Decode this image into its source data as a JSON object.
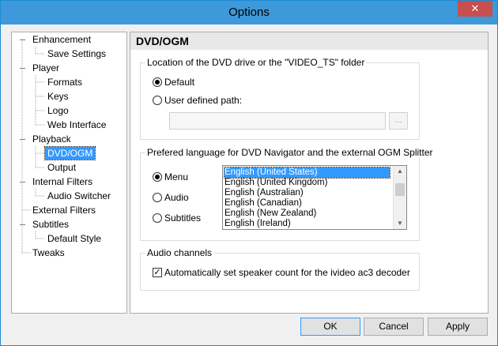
{
  "window": {
    "title": "Options",
    "close_glyph": "✕"
  },
  "tree": {
    "items": [
      {
        "label": "Enhancement",
        "level": 0
      },
      {
        "label": "Save Settings",
        "level": 1
      },
      {
        "label": "Player",
        "level": 0
      },
      {
        "label": "Formats",
        "level": 1
      },
      {
        "label": "Keys",
        "level": 1
      },
      {
        "label": "Logo",
        "level": 1
      },
      {
        "label": "Web Interface",
        "level": 1
      },
      {
        "label": "Playback",
        "level": 0
      },
      {
        "label": "DVD/OGM",
        "level": 1,
        "selected": true
      },
      {
        "label": "Output",
        "level": 1
      },
      {
        "label": "Internal Filters",
        "level": 0
      },
      {
        "label": "Audio Switcher",
        "level": 1
      },
      {
        "label": "External Filters",
        "level": 0
      },
      {
        "label": "Subtitles",
        "level": 0
      },
      {
        "label": "Default Style",
        "level": 1
      },
      {
        "label": "Tweaks",
        "level": 0
      }
    ]
  },
  "panel": {
    "title": "DVD/OGM",
    "location_group": {
      "label": "Location of the DVD drive or the \"VIDEO_TS\" folder",
      "default_label": "Default",
      "default_checked": true,
      "user_path_label": "User defined path:",
      "user_path_checked": false,
      "path_value": "",
      "browse_label": "..."
    },
    "language_group": {
      "label": "Prefered language for DVD Navigator and the external OGM Splitter",
      "menu_label": "Menu",
      "menu_checked": true,
      "audio_label": "Audio",
      "audio_checked": false,
      "subtitles_label": "Subtitles",
      "subtitles_checked": false,
      "languages": [
        "English (United States)",
        "English (United Kingdom)",
        "English (Australian)",
        "English (Canadian)",
        "English (New Zealand)",
        "English (Ireland)"
      ],
      "selected_language": "English (United States)"
    },
    "audio_group": {
      "label": "Audio channels",
      "auto_speaker_label": "Automatically set speaker count for the ivideo ac3 decoder",
      "auto_speaker_checked": true
    }
  },
  "buttons": {
    "ok": "OK",
    "cancel": "Cancel",
    "apply": "Apply"
  },
  "colors": {
    "titlebar": "#3d99d9",
    "selection": "#3399ff",
    "close": "#c74f4f"
  }
}
